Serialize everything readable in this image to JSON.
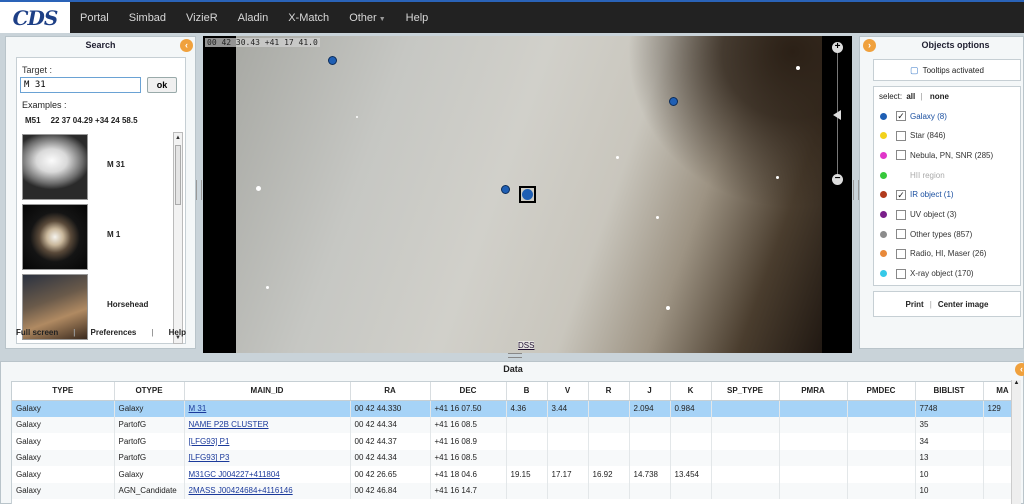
{
  "logo": "CDS",
  "nav": [
    "Portal",
    "Simbad",
    "VizieR",
    "Aladin",
    "X-Match",
    "Other",
    "Help"
  ],
  "search": {
    "title": "Search",
    "target_label": "Target :",
    "target_value": "M 31",
    "ok_label": "ok",
    "examples_label": "Examples :",
    "example_links": [
      "M51",
      "22 37 04.29 +34 24 58.5"
    ],
    "examples": [
      "M 31",
      "M 1",
      "Horsehead"
    ],
    "links": [
      "Full screen",
      "Preferences",
      "Help"
    ]
  },
  "sky": {
    "coords": "00 42 30.43 +41 17 41.0",
    "survey": "DSS"
  },
  "objects": {
    "title": "Objects options",
    "tooltips": "Tooltips activated",
    "select_label": "select:",
    "select_all": "all",
    "select_none": "none",
    "types": [
      {
        "label": "Galaxy (8)",
        "color": "#1f5fb4",
        "checked": true
      },
      {
        "label": "Star (846)",
        "color": "#f2d21b",
        "checked": false
      },
      {
        "label": "Nebula, PN, SNR (285)",
        "color": "#e036c9",
        "checked": false
      },
      {
        "label": "HII region",
        "color": "#36c83a",
        "checked": false,
        "disabled": true
      },
      {
        "label": "IR object (1)",
        "color": "#b13a1d",
        "checked": true
      },
      {
        "label": "UV object (3)",
        "color": "#7a1f8a",
        "checked": false
      },
      {
        "label": "Other types (857)",
        "color": "#8c8c8c",
        "checked": false
      },
      {
        "label": "Radio, HI, Maser (26)",
        "color": "#e8893a",
        "checked": false
      },
      {
        "label": "X-ray object (170)",
        "color": "#36c9e8",
        "checked": false
      }
    ],
    "print": "Print",
    "center_image": "Center image"
  },
  "data": {
    "title": "Data",
    "columns": [
      "TYPE",
      "OTYPE",
      "MAIN_ID",
      "RA",
      "DEC",
      "B",
      "V",
      "R",
      "J",
      "K",
      "SP_TYPE",
      "PMRA",
      "PMDEC",
      "BIBLIST",
      "MA"
    ],
    "rows": [
      [
        "Galaxy",
        "Galaxy",
        "M 31",
        "00 42 44.330",
        "+41 16 07.50",
        "4.36",
        "3.44",
        "",
        "2.094",
        "0.984",
        "",
        "",
        "",
        "7748",
        "129"
      ],
      [
        "Galaxy",
        "PartofG",
        "NAME P2B CLUSTER",
        "00 42 44.34",
        "+41 16 08.5",
        "",
        "",
        "",
        "",
        "",
        "",
        "",
        "",
        "35",
        ""
      ],
      [
        "Galaxy",
        "PartofG",
        "[LFG93] P1",
        "00 42 44.37",
        "+41 16 08.9",
        "",
        "",
        "",
        "",
        "",
        "",
        "",
        "",
        "34",
        ""
      ],
      [
        "Galaxy",
        "PartofG",
        "[LFG93] P3",
        "00 42 44.34",
        "+41 16 08.5",
        "",
        "",
        "",
        "",
        "",
        "",
        "",
        "",
        "13",
        ""
      ],
      [
        "Galaxy",
        "Galaxy",
        "M31GC J004227+411804",
        "00 42 26.65",
        "+41 18 04.6",
        "19.15",
        "17.17",
        "16.92",
        "14.738",
        "13.454",
        "",
        "",
        "",
        "10",
        ""
      ],
      [
        "Galaxy",
        "AGN_Candidate",
        "2MASS J00424684+4116146",
        "00 42 46.84",
        "+41 16 14.7",
        "",
        "",
        "",
        "",
        "",
        "",
        "",
        "",
        "10",
        ""
      ]
    ]
  }
}
